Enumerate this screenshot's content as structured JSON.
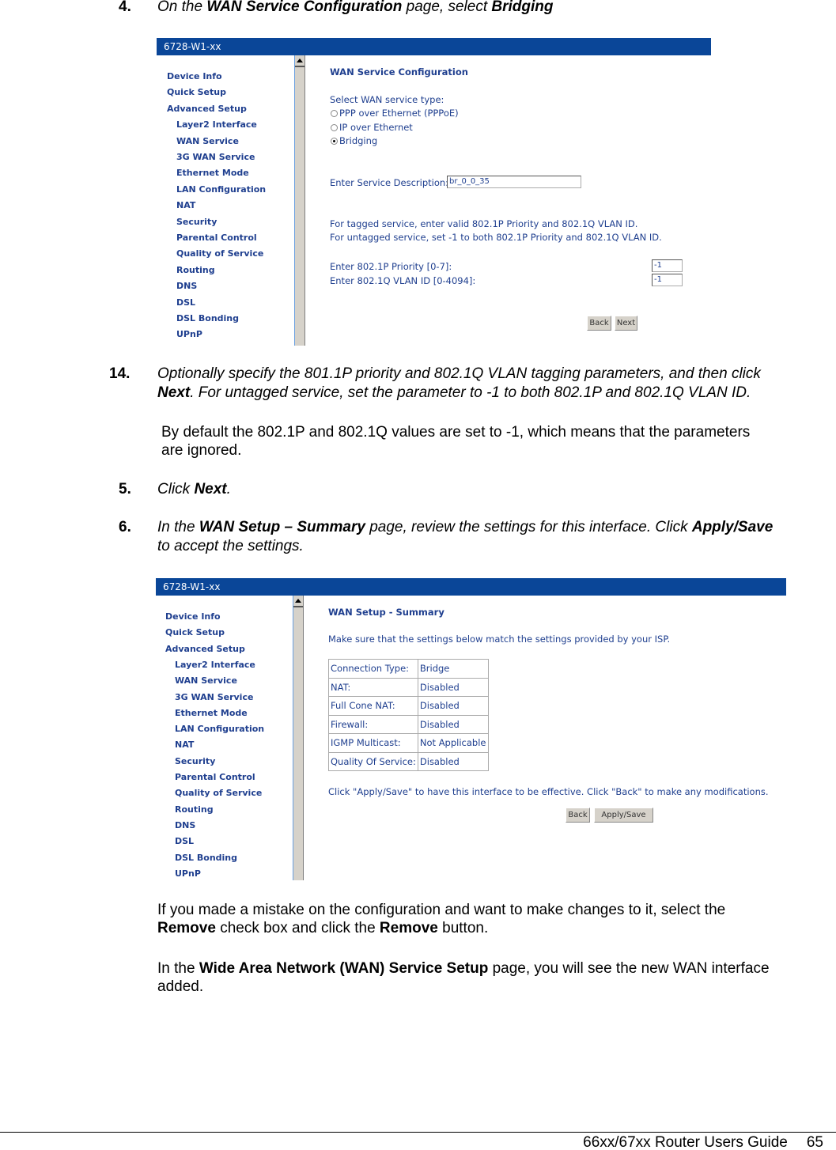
{
  "step4": {
    "number": "4.",
    "parts": [
      "On the ",
      "WAN Service Configuration",
      " page, select ",
      "Bridging"
    ]
  },
  "screenshot1": {
    "window_title": "6728-W1-xx",
    "nav": {
      "top_items": [
        "Device Info",
        "Quick Setup",
        "Advanced Setup"
      ],
      "sub_items": [
        "Layer2 Interface",
        "WAN Service",
        "3G WAN Service",
        "Ethernet Mode",
        "LAN Configuration",
        "NAT",
        "Security",
        "Parental Control",
        "Quality of Service",
        "Routing",
        "DNS",
        "DSL",
        "DSL Bonding",
        "UPnP"
      ]
    },
    "heading": "WAN Service Configuration",
    "select_label": "Select WAN service type:",
    "options": [
      {
        "label": "PPP over Ethernet (PPPoE)",
        "selected": false
      },
      {
        "label": "IP over Ethernet",
        "selected": false
      },
      {
        "label": "Bridging",
        "selected": true
      }
    ],
    "service_desc_label": "Enter Service Description:",
    "service_desc_value": "br_0_0_35",
    "tagged_note": "For tagged service, enter valid 802.1P Priority and 802.1Q VLAN ID.",
    "untagged_note": "For untagged service, set -1 to both 802.1P Priority and 802.1Q VLAN ID.",
    "priority_label": "Enter 802.1P Priority [0-7]:",
    "priority_value": "-1",
    "vlan_label": "Enter 802.1Q VLAN ID [0-4094]:",
    "vlan_value": "-1",
    "back_label": "Back",
    "next_label": "Next"
  },
  "step14": {
    "number": "14.",
    "line1": "Optionally specify the 801.1P priority and 802.1Q VLAN tagging parameters, and then click",
    "line2_bold": "Next",
    "line2_rest": ".  For untagged service, set the parameter to -1 to both 802.1P and 802.1Q VLAN ID."
  },
  "default_note": {
    "line1": "By default the 802.1P and 802.1Q values are set to -1, which means that the parameters",
    "line2": "are ignored."
  },
  "step5": {
    "number": "5.",
    "prefix": "Click ",
    "bold": "Next",
    "suffix": "."
  },
  "step6": {
    "number": "6.",
    "p1": "In the ",
    "b1": "WAN Setup – Summary",
    "p2": " page, review the settings for this interface. Click ",
    "b2": "Apply/Save",
    "line2": "to accept the settings."
  },
  "screenshot2": {
    "window_title": "6728-W1-xx",
    "nav": {
      "top_items": [
        "Device Info",
        "Quick Setup",
        "Advanced Setup"
      ],
      "sub_items": [
        "Layer2 Interface",
        "WAN Service",
        "3G WAN Service",
        "Ethernet Mode",
        "LAN Configuration",
        "NAT",
        "Security",
        "Parental Control",
        "Quality of Service",
        "Routing",
        "DNS",
        "DSL",
        "DSL Bonding",
        "UPnP"
      ]
    },
    "heading": "WAN Setup - Summary",
    "intro": "Make sure that the settings below match the settings provided by your ISP.",
    "rows": [
      {
        "label": "Connection Type:",
        "value": "Bridge"
      },
      {
        "label": "NAT:",
        "value": "Disabled"
      },
      {
        "label": "Full Cone NAT:",
        "value": "Disabled"
      },
      {
        "label": "Firewall:",
        "value": "Disabled"
      },
      {
        "label": "IGMP Multicast:",
        "value": "Not Applicable"
      },
      {
        "label": "Quality Of Service:",
        "value": "Disabled"
      }
    ],
    "note": "Click \"Apply/Save\" to have this interface to be effective. Click \"Back\" to make any modifications.",
    "back_label": "Back",
    "apply_label": "Apply/Save"
  },
  "mistake_note": {
    "line1": "If you made a mistake on the configuration and want to make changes to it, select the",
    "b1": "Remove",
    "mid": " check box and click the ",
    "b2": "Remove",
    "end": " button."
  },
  "wan_note": {
    "p1": "In the ",
    "b1": "Wide Area Network (WAN) Service Setup",
    "p2": " page, you will see the new WAN interface",
    "line2": "added."
  },
  "footer": {
    "guide_title": "66xx/67xx Router Users Guide",
    "page_number": "65"
  }
}
